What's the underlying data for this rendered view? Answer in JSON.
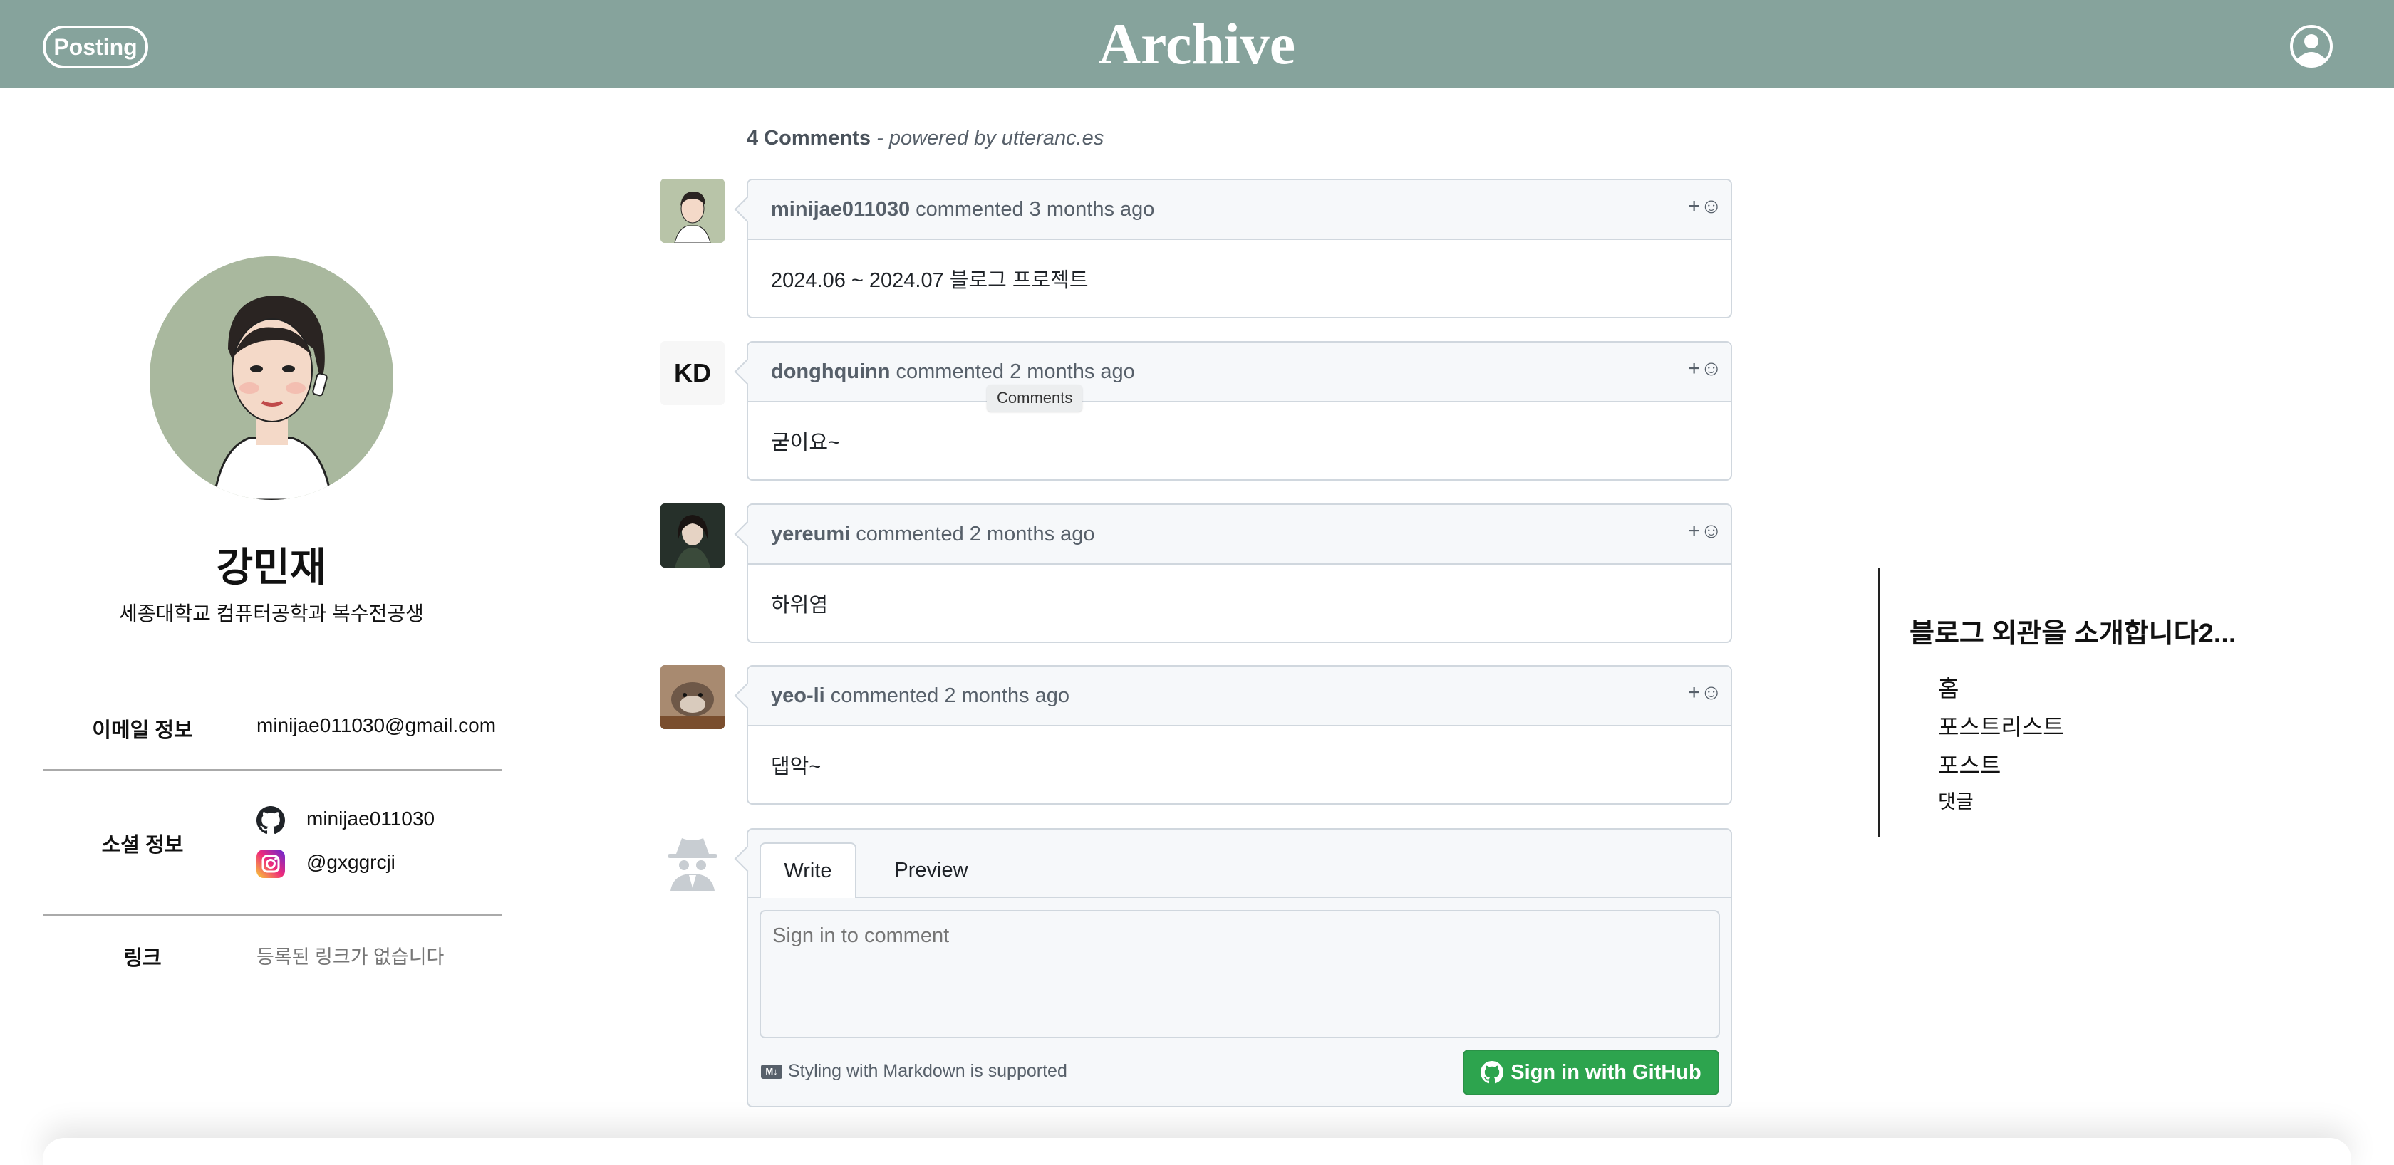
{
  "header": {
    "posting_label": "Posting",
    "title": "Archive",
    "colors": {
      "background": "#86a39c",
      "text": "#ffffff"
    }
  },
  "profile": {
    "name": "강민재",
    "bio": "세종대학교 컴퓨터공학과 복수전공생",
    "email_label": "이메일 정보",
    "email": "minijae011030@gmail.com",
    "social_label": "소셜 정보",
    "github": "minijae011030",
    "instagram": "@gxggrcji",
    "link_label": "링크",
    "link_empty": "등록된 링크가 없습니다"
  },
  "comments": {
    "count_label": "4 Comments",
    "powered_by": "- powered by utteranc.es",
    "tooltip": "Comments",
    "items": [
      {
        "author": "minijae011030",
        "action": "commented 3 months ago",
        "body": "2024.06 ~ 2024.07 블로그 프로젝트",
        "react": "+☺"
      },
      {
        "author": "donghquinn",
        "action": "commented 2 months ago",
        "body": "굳이요~",
        "react": "+☺",
        "avatar_text": "KD"
      },
      {
        "author": "yereumi",
        "action": "commented 2 months ago",
        "body": "하위염",
        "react": "+☺"
      },
      {
        "author": "yeo-li",
        "action": "commented 2 months ago",
        "body": "댑악~",
        "react": "+☺"
      }
    ],
    "form": {
      "tab_write": "Write",
      "tab_preview": "Preview",
      "placeholder": "Sign in to comment",
      "markdown_note": "Styling with Markdown is supported",
      "signin_label": "Sign in with GitHub",
      "colors": {
        "signin_button": "#2da44e"
      }
    }
  },
  "toc": {
    "title": "블로그 외관을 소개합니다2...",
    "items": [
      "홈",
      "포스트리스트",
      "포스트",
      "댓글"
    ]
  },
  "icons": [
    "user-circle-icon",
    "github-icon",
    "instagram-icon",
    "smiley-icon",
    "markdown-icon",
    "anonymous-spy-icon"
  ]
}
